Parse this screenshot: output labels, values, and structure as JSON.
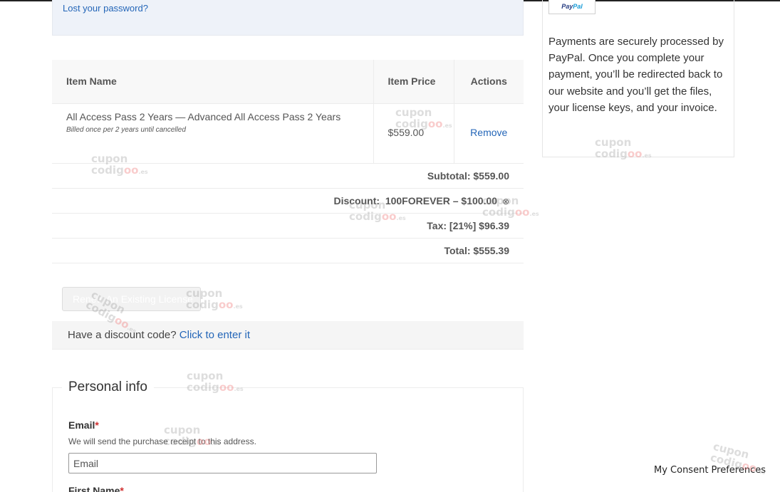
{
  "login": {
    "lost_password": "Lost your password?"
  },
  "cart": {
    "headers": {
      "name": "Item Name",
      "price": "Item Price",
      "actions": "Actions"
    },
    "items": [
      {
        "title": "All Access Pass 2 Years — Advanced All Access Pass 2 Years",
        "billing": "Billed once per 2 years until cancelled",
        "price": "$559.00",
        "action": "Remove"
      }
    ],
    "subtotal": "Subtotal: $559.00",
    "discount_label": "Discount:",
    "discount_value": "100FOREVER – $100.00",
    "discount_remove_icon": "⊗",
    "tax": "Tax: [21%] $96.39",
    "total": "Total: $555.39"
  },
  "renew_button": "Renew An Existing License",
  "discount_prompt": {
    "text": "Have a discount code?",
    "link": "Click to enter it"
  },
  "personal_info": {
    "title": "Personal info",
    "email_label": "Email",
    "required_mark": "*",
    "email_desc": "We will send the purchase receipt to this address.",
    "email_placeholder": "Email",
    "first_name_label": "First Name"
  },
  "side": {
    "paypal_logo_a": "Pay",
    "paypal_logo_b": "Pal",
    "description": "Payments are securely processed by PayPal. Once you complete your payment, you’ll be redirected back to our website and you’ll get the files, your license keys, and your invoice."
  },
  "consent_button": "My Consent Preferences",
  "watermark": {
    "line1": "cupon",
    "line2_a": "codig",
    "line2_o": "oo",
    "line2_es": ".es"
  }
}
